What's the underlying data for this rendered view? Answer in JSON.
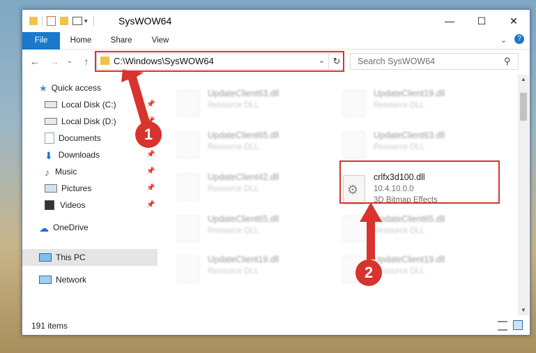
{
  "window": {
    "title": "SysWOW64",
    "controls": {
      "minimize": "—",
      "maximize": "☐",
      "close": "✕"
    }
  },
  "ribbon": {
    "tabs": [
      "File",
      "Home",
      "Share",
      "View"
    ],
    "help_icon": "?"
  },
  "navigation": {
    "back": "←",
    "forward": "→",
    "recent": "⌄",
    "up": "↑"
  },
  "address": {
    "path": "C:\\Windows\\SysWOW64",
    "dropdown": "⌄",
    "refresh": "↻"
  },
  "search": {
    "placeholder": "Search SysWOW64"
  },
  "sidebar": {
    "items": [
      {
        "label": "Quick access",
        "icon": "star-icon"
      },
      {
        "label": "Local Disk (C:)",
        "icon": "drive-icon",
        "pinned": true
      },
      {
        "label": "Local Disk (D:)",
        "icon": "drive-icon",
        "pinned": true
      },
      {
        "label": "Documents",
        "icon": "documents-icon",
        "pinned": true
      },
      {
        "label": "Downloads",
        "icon": "downloads-icon",
        "pinned": true
      },
      {
        "label": "Music",
        "icon": "music-icon",
        "pinned": true
      },
      {
        "label": "Pictures",
        "icon": "pictures-icon",
        "pinned": true
      },
      {
        "label": "Videos",
        "icon": "videos-icon",
        "pinned": true
      },
      {
        "label": "OneDrive",
        "icon": "cloud-icon"
      },
      {
        "label": "This PC",
        "icon": "computer-icon",
        "selected": true
      },
      {
        "label": "Network",
        "icon": "network-icon"
      }
    ]
  },
  "files": {
    "column_left": [
      {
        "name": "UpdateClient63.dll",
        "type": "Resource DLL"
      },
      {
        "name": "UpdateClient65.dll",
        "type": "Resource DLL"
      },
      {
        "name": "UpdateClient42.dll",
        "type": "Resource DLL"
      },
      {
        "name": "UpdateClient65.dll",
        "type": "Resource DLL"
      },
      {
        "name": "UpdateClient19.dll",
        "type": "Resource DLL"
      }
    ],
    "column_right": [
      {
        "name": "UpdateClient19.dll",
        "type": "Resource DLL"
      },
      {
        "name": "UpdateClient63.dll",
        "type": "Resource DLL"
      },
      {
        "name": "crlfx3d100.dll",
        "version": "10.4.10.0.0",
        "type": "3D Bitmap Effects",
        "highlighted": true
      },
      {
        "name": "UpdateClient65.dll",
        "type": "Resource DLL"
      },
      {
        "name": "UpdateClient19.dll",
        "type": "Resource DLL"
      }
    ]
  },
  "status": {
    "item_count": "191 items"
  },
  "annotations": {
    "step1": "1",
    "step2": "2",
    "color": "#d8332d"
  }
}
